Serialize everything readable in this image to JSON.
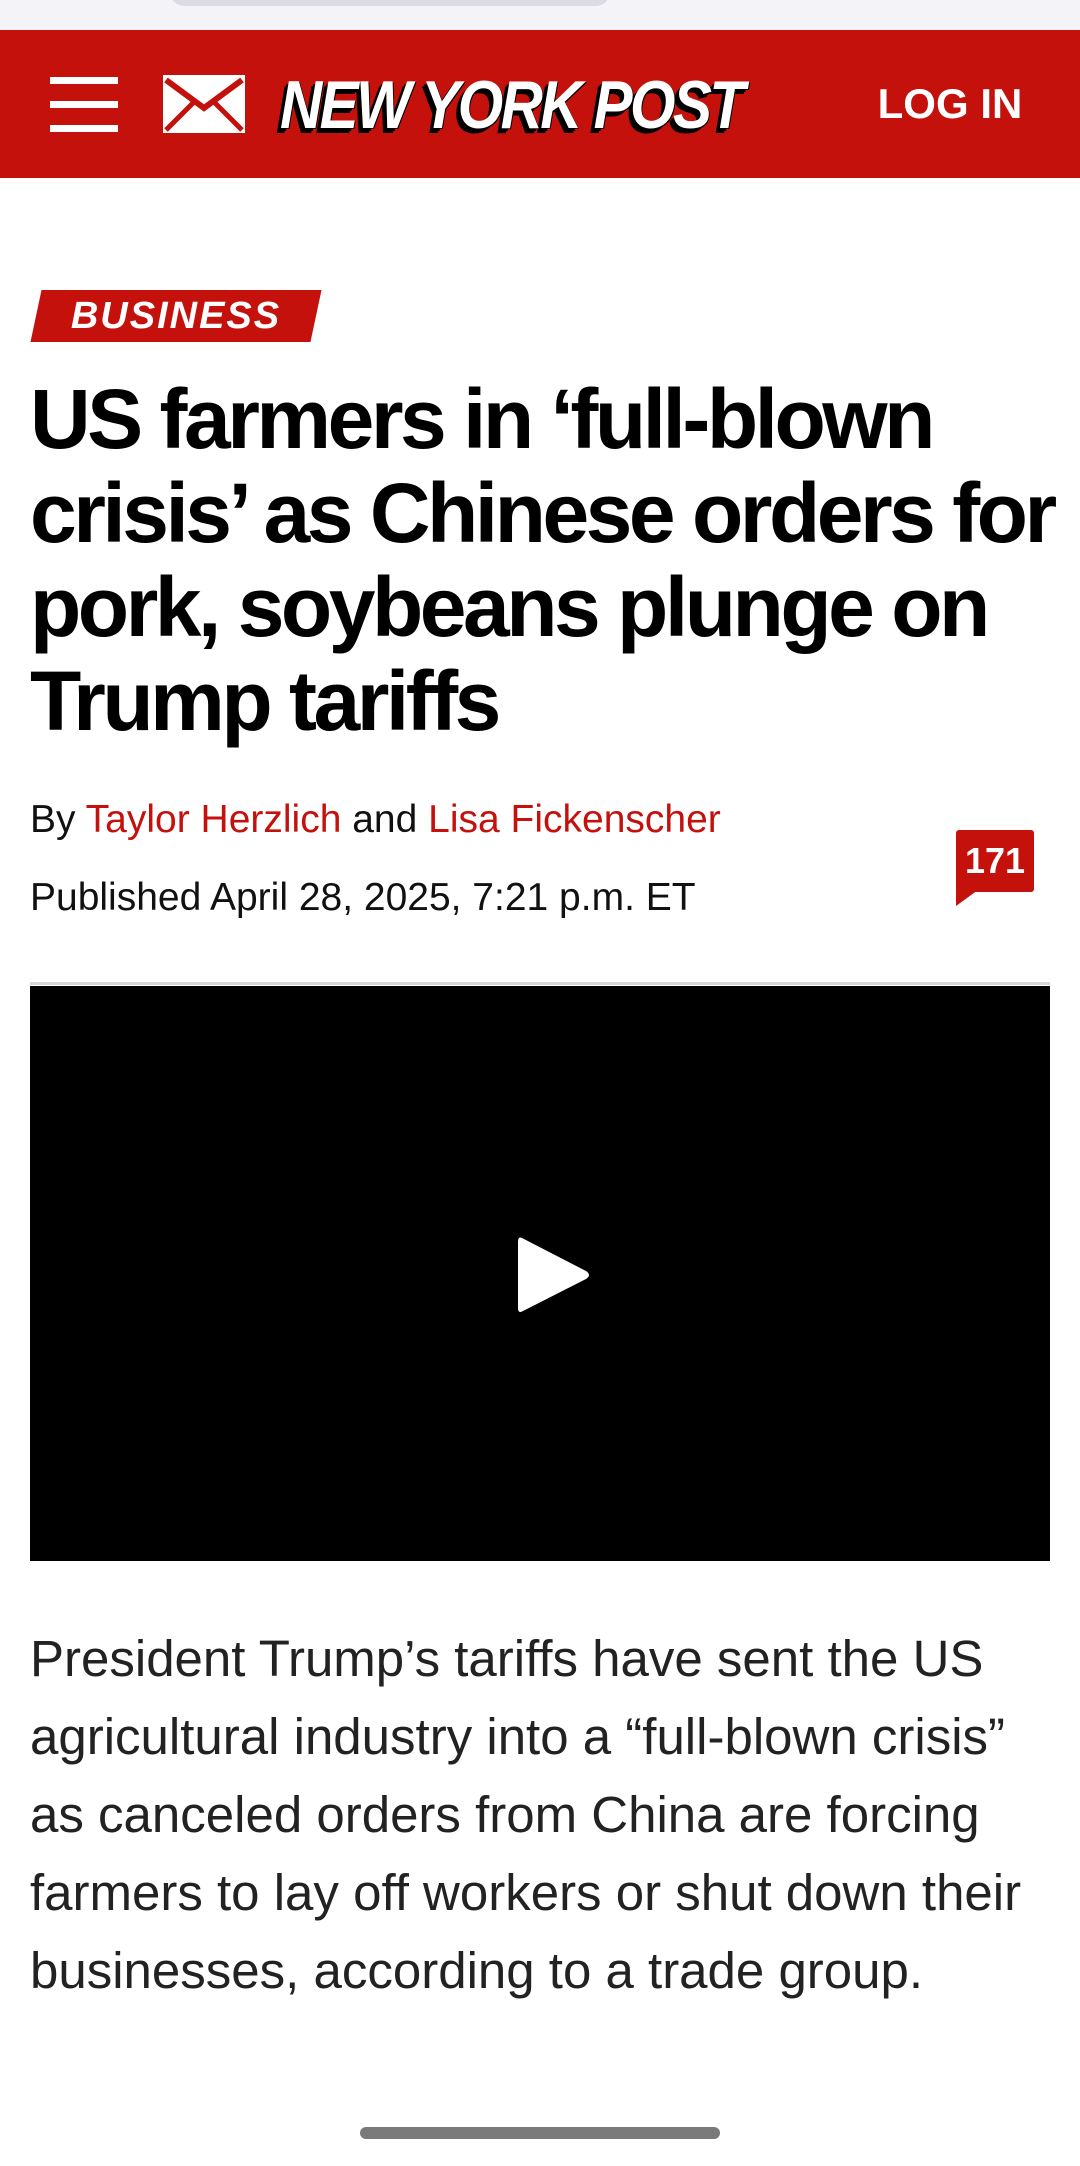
{
  "header": {
    "logo_text": "NEW YORK POST",
    "login_label": "LOG IN",
    "menu_icon": "hamburger-menu-icon",
    "mail_icon": "envelope-icon",
    "bg_color": "#c4110c"
  },
  "article": {
    "section": "BUSINESS",
    "headline": "US farmers in ‘full-blown crisis’ as Chinese orders for pork, soybeans plunge on Trump tariffs",
    "byline": {
      "prefix": "By",
      "author1": "Taylor Herzlich",
      "conjunction": "and",
      "author2": "Lisa Fickenscher"
    },
    "published": "Published April 28, 2025, 7:21 p.m. ET",
    "comment_count": "171",
    "video": {
      "play_icon": "play-icon"
    },
    "lede": "President Trump’s tariffs have sent the US agricultural industry into a “full-blown crisis” as canceled orders from China are forcing farmers to lay off workers or shut down their businesses, according to a trade group."
  },
  "colors": {
    "accent": "#c4110c",
    "text": "#111111",
    "video_bg": "#000000"
  }
}
